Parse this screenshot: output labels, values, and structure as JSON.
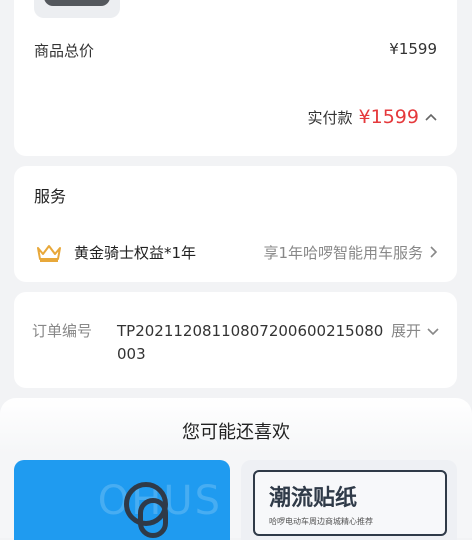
{
  "order": {
    "subtotal_label": "商品总价",
    "subtotal_value": "¥1599",
    "paid_label": "实付款",
    "paid_value": "¥1599",
    "paid_color": "#e5393c"
  },
  "service": {
    "title": "服务",
    "icon": "crown-icon",
    "name": "黄金骑士权益*1年",
    "desc": "享1年哈啰智能用车服务"
  },
  "order_info": {
    "number_label": "订单编号",
    "number_value": "TP20211208110807200600215080003",
    "expand_label": "展开"
  },
  "recommend": {
    "title": "您可能还喜欢",
    "items": [
      {
        "name": "lock-product",
        "bg": "#1f9bf0"
      },
      {
        "title": "潮流贴纸",
        "subtitle": "哈啰电动车周边商城精心推荐"
      }
    ]
  }
}
